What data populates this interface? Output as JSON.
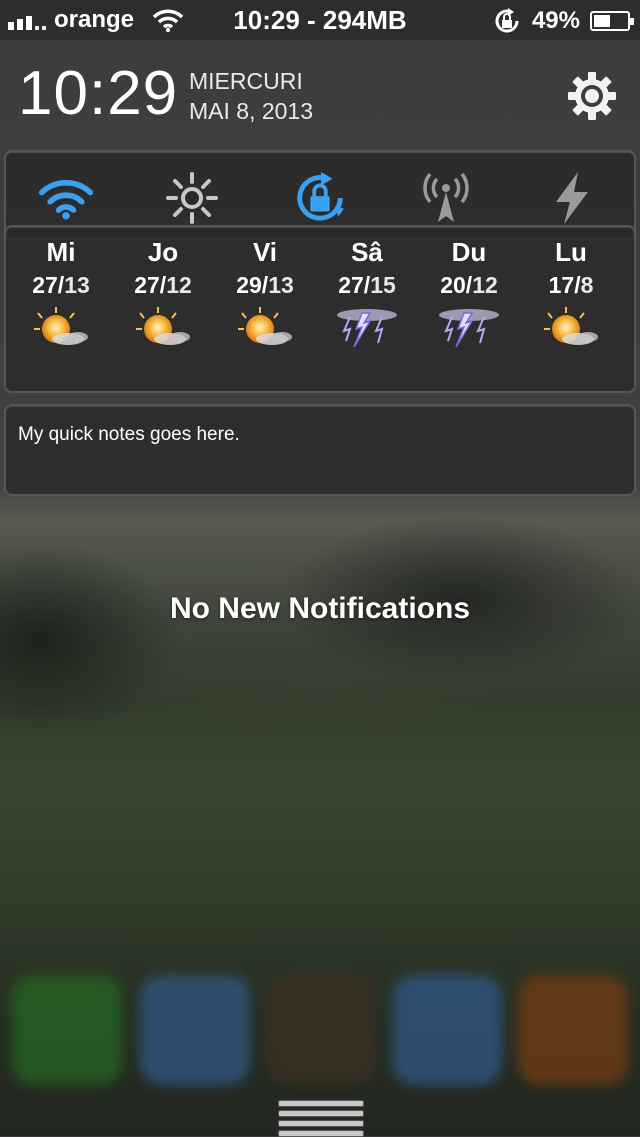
{
  "status_bar": {
    "carrier": "orange",
    "center_text": "10:29 - 294MB",
    "battery_percent": "49%",
    "battery_level": 0.49
  },
  "clock": {
    "time": "10:29",
    "day": "MIERCURI",
    "date": "MAI 8, 2013"
  },
  "toggles": {
    "items": [
      {
        "name": "wifi",
        "color": "#3aa0f0",
        "active": true
      },
      {
        "name": "brightness",
        "color": "#b8b8b8",
        "active": false
      },
      {
        "name": "rotation-lock",
        "color": "#3aa0f0",
        "active": true
      },
      {
        "name": "cellular-data",
        "color": "#9a9a9a",
        "active": false
      },
      {
        "name": "power",
        "color": "#9a9a9a",
        "active": false
      }
    ]
  },
  "weather": {
    "days": [
      {
        "name": "Mi",
        "high": "27/",
        "low": "13",
        "icon": "sun-cloud-icon"
      },
      {
        "name": "Jo",
        "high": "27/",
        "low": "12",
        "icon": "sun-cloud-icon"
      },
      {
        "name": "Vi",
        "high": "29/",
        "low": "13",
        "icon": "sun-cloud-icon"
      },
      {
        "name": "Sâ",
        "high": "27/",
        "low": "15",
        "icon": "thunderstorm-icon"
      },
      {
        "name": "Du",
        "high": "20/",
        "low": "12",
        "icon": "thunderstorm-icon"
      },
      {
        "name": "Lu",
        "high": "17/",
        "low": "8",
        "icon": "sun-cloud-icon"
      }
    ]
  },
  "notes": {
    "text": "My quick notes goes here."
  },
  "notifications": {
    "empty_text": "No New Notifications"
  },
  "colors": {
    "accent": "#3aa0f0"
  }
}
